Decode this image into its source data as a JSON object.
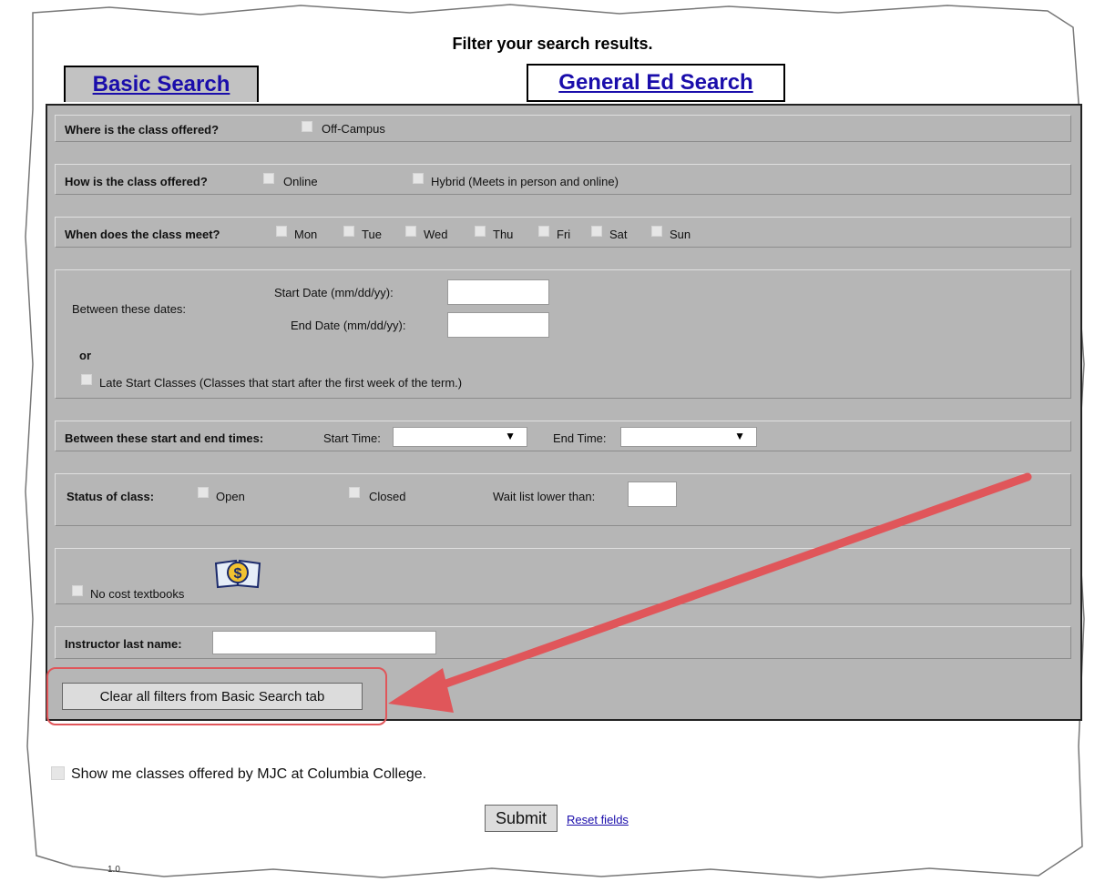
{
  "page": {
    "title": "Filter your search results.",
    "version": "1.0"
  },
  "tabs": {
    "basic": "Basic Search",
    "general_ed": "General Ed Search"
  },
  "location": {
    "question": "Where is the class offered?",
    "off_campus": "Off-Campus"
  },
  "format": {
    "question": "How is the class offered?",
    "online": "Online",
    "hybrid": "Hybrid (Meets in person and online)"
  },
  "days": {
    "question": "When does the class meet?",
    "items": [
      "Mon",
      "Tue",
      "Wed",
      "Thu",
      "Fri",
      "Sat",
      "Sun"
    ]
  },
  "dates": {
    "between_label": "Between these dates:",
    "start_label": "Start Date (mm/dd/yy):",
    "end_label": "End Date (mm/dd/yy):",
    "or": "or",
    "late_start": "Late Start Classes (Classes that start after the first week of the term.)"
  },
  "times": {
    "label": "Between these start and end times:",
    "start_label": "Start Time:",
    "end_label": "End Time:"
  },
  "status": {
    "label": "Status of class:",
    "open": "Open",
    "closed": "Closed",
    "waitlist": "Wait list lower than:"
  },
  "textbooks": {
    "label": "No cost textbooks",
    "icon": "no-cost-textbook-icon"
  },
  "instructor": {
    "label": "Instructor last name:"
  },
  "buttons": {
    "clear": "Clear all filters from Basic Search tab",
    "submit": "Submit",
    "reset": "Reset fields"
  },
  "mjc": {
    "label": "Show me classes offered by MJC at Columbia College."
  },
  "colors": {
    "panel": "#b6b6b6",
    "link": "#1a0dab",
    "annotation": "#e0565a"
  }
}
